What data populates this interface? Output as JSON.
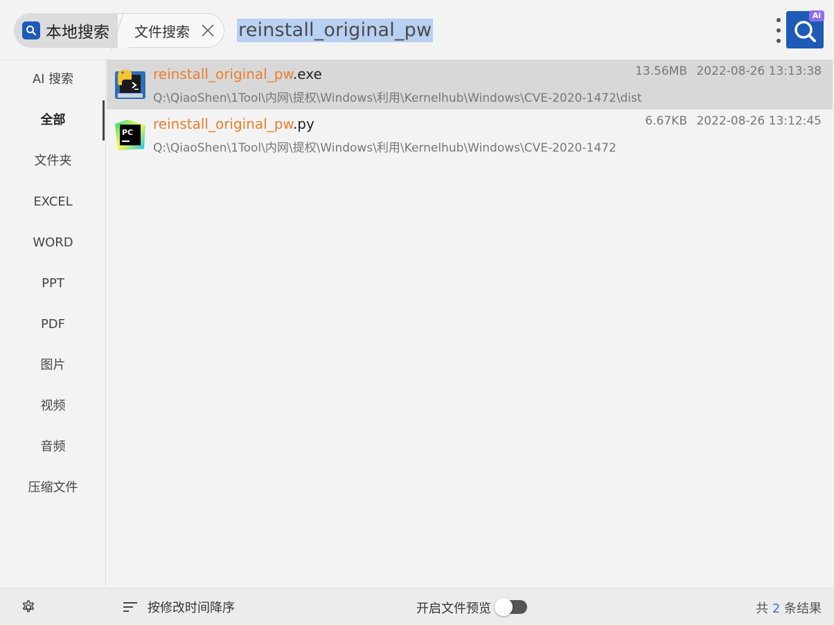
{
  "colors": {
    "accent": "#1e5ab6",
    "highlight": "#ea7e2c",
    "ai_badge": "#8c6ff0",
    "selection": "#b8d0f2"
  },
  "header": {
    "tab_local": "本地搜索",
    "tab_file": "文件搜索",
    "query": "reinstall_original_pw",
    "ai_badge": "Ai"
  },
  "sidebar": {
    "items": [
      {
        "label": "AI 搜索"
      },
      {
        "label": "全部",
        "active": true
      },
      {
        "label": "文件夹"
      },
      {
        "label": "EXCEL"
      },
      {
        "label": "WORD"
      },
      {
        "label": "PPT"
      },
      {
        "label": "PDF"
      },
      {
        "label": "图片"
      },
      {
        "label": "视频"
      },
      {
        "label": "音频"
      },
      {
        "label": "压缩文件"
      }
    ]
  },
  "results": [
    {
      "name_match": "reinstall_original_pw",
      "name_ext": ".exe",
      "path": "Q:\\QiaoShen\\1Tool\\内网\\提权\\Windows\\利用\\Kernelhub\\Windows\\CVE-2020-1472\\dist",
      "size": "13.56MB",
      "date": "2022-08-26 13:13:38",
      "icon": "python-exe-icon"
    },
    {
      "name_match": "reinstall_original_pw",
      "name_ext": ".py",
      "path": "Q:\\QiaoShen\\1Tool\\内网\\提权\\Windows\\利用\\Kernelhub\\Windows\\CVE-2020-1472",
      "size": "6.67KB",
      "date": "2022-08-26 13:12:45",
      "icon": "pycharm-icon",
      "icon_text": "PC"
    }
  ],
  "footer": {
    "sort_label": "按修改时间降序",
    "preview_label": "开启文件预览",
    "preview_enabled": false,
    "count_prefix": "共",
    "count_num": "2",
    "count_suffix": "条结果"
  }
}
